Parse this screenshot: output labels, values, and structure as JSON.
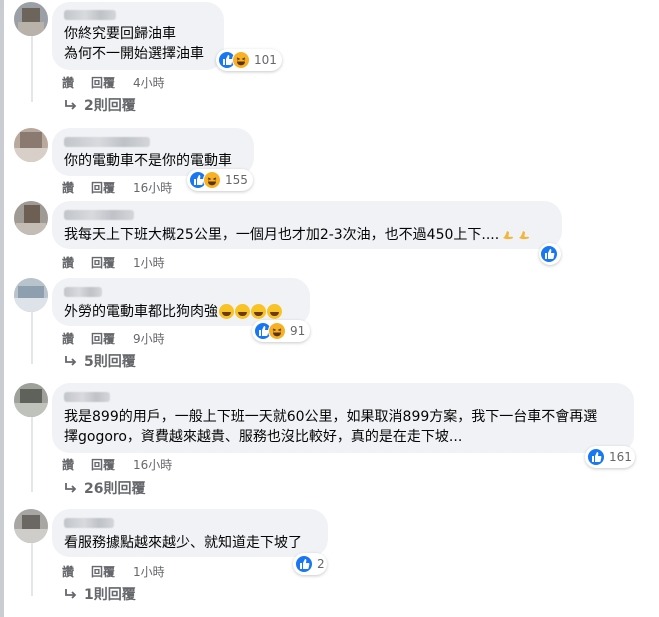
{
  "colors": {
    "bubble": "#f0f2f5",
    "text": "#050505",
    "muted": "#65676b",
    "like_blue": "#1877f2",
    "haha_yellow": "#f7b125"
  },
  "comments": [
    {
      "lines": [
        "你終究要回歸油車",
        "為何不一開始選擇油車"
      ],
      "like_label": "讚",
      "reply_label": "回覆",
      "time": "4小時",
      "reactions": [
        "like-icon",
        "haha-icon"
      ],
      "reaction_count": "101",
      "replies": "2則回覆"
    },
    {
      "lines": [
        "你的電動車不是你的電動車"
      ],
      "like_label": "讚",
      "reply_label": "回覆",
      "time": "16小時",
      "reactions": [
        "like-icon",
        "haha-icon"
      ],
      "reaction_count": "155"
    },
    {
      "lines": [
        "我每天上下班大概25公里，一個月也才加2-3次油，也不過450上下...."
      ],
      "like_label": "讚",
      "reply_label": "回覆",
      "time": "1小時",
      "reactions": [
        "like-icon"
      ],
      "reaction_count": ""
    },
    {
      "lines": [
        "外勞的電動車都比狗肉強"
      ],
      "like_label": "讚",
      "reply_label": "回覆",
      "time": "9小時",
      "reactions": [
        "like-icon",
        "haha-icon"
      ],
      "reaction_count": "91",
      "replies": "5則回覆"
    },
    {
      "lines": [
        "我是899的用戶，一般上下班一天就60公里，如果取消899方案，我下一台車不會再選",
        "擇gogoro，資費越來越貴、服務也沒比較好，真的是在走下坡..."
      ],
      "like_label": "讚",
      "reply_label": "回覆",
      "time": "16小時",
      "reactions": [
        "like-icon"
      ],
      "reaction_count": "161",
      "replies": "26則回覆"
    },
    {
      "lines": [
        "看服務據點越來越少、就知道走下坡了"
      ],
      "like_label": "讚",
      "reply_label": "回覆",
      "time": "1小時",
      "reactions": [
        "like-icon"
      ],
      "reaction_count": "2",
      "replies": "1則回覆"
    }
  ]
}
